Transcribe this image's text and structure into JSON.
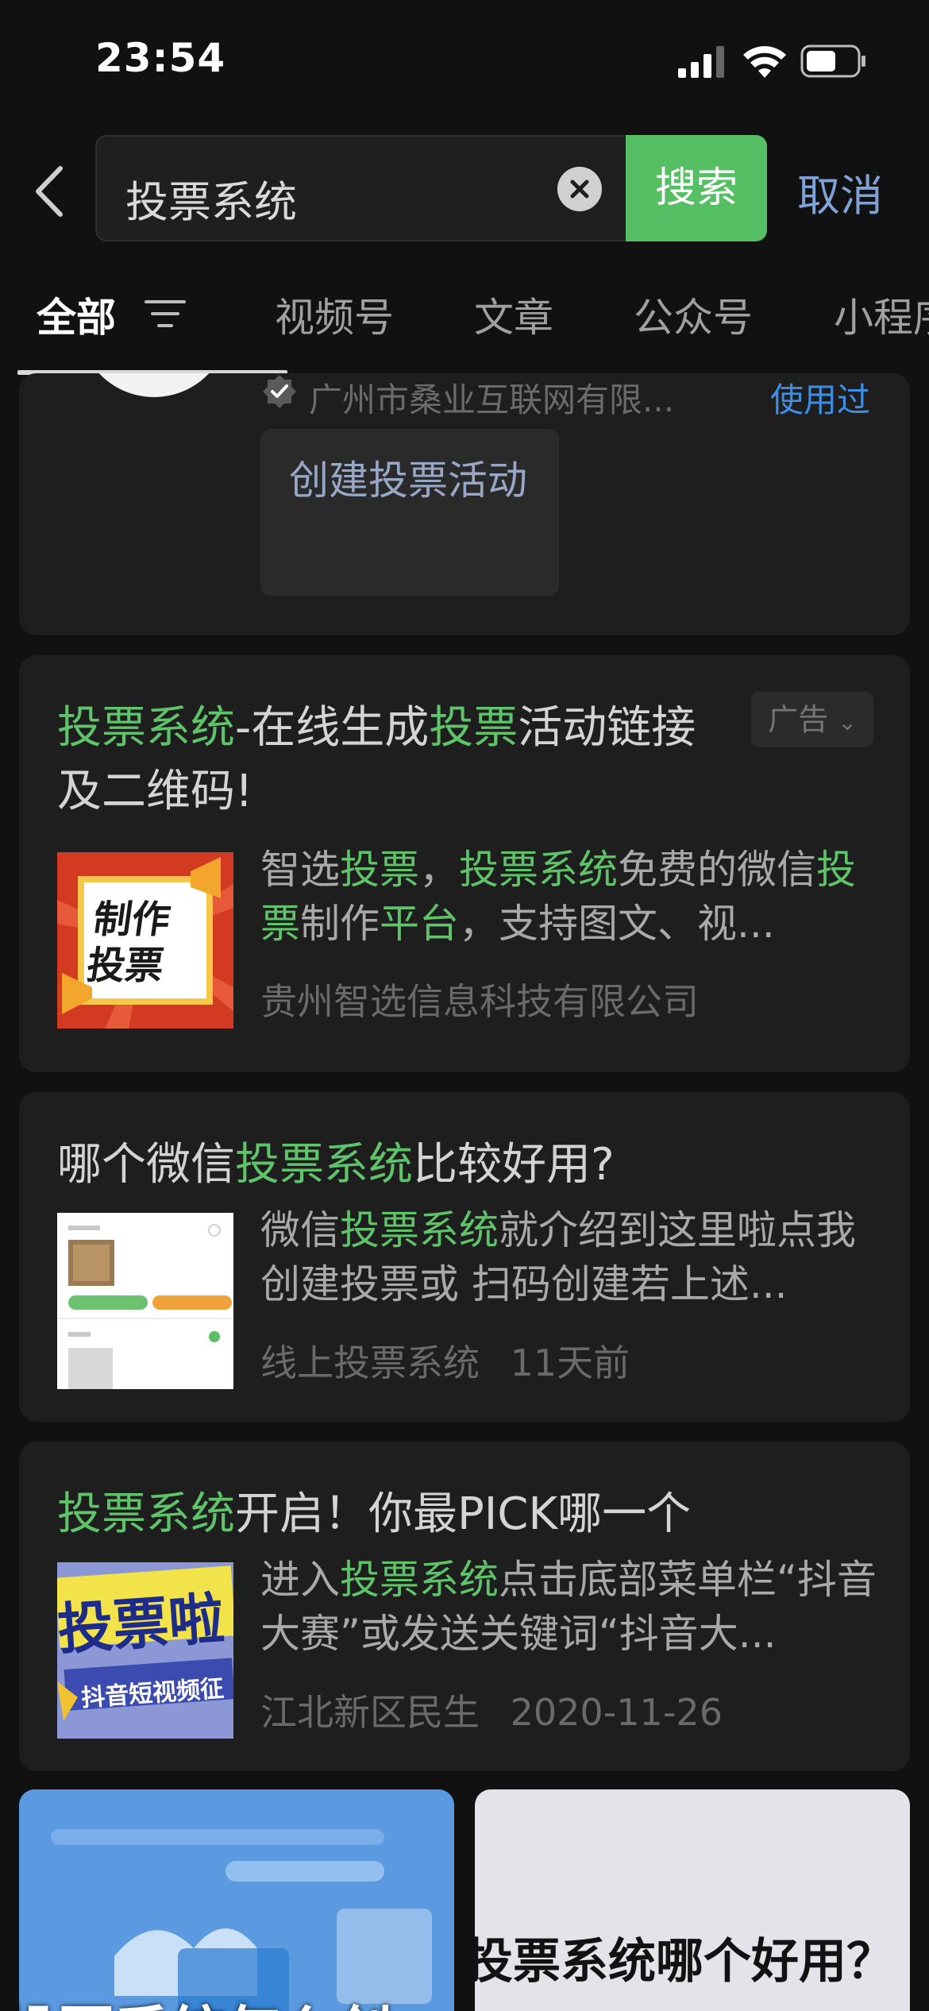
{
  "status_bar": {
    "time": "23:54"
  },
  "search": {
    "query": "投票系统",
    "search_button": "搜索",
    "cancel": "取消"
  },
  "tabs": [
    {
      "label": "全部",
      "active": true
    },
    {
      "label": "视频号",
      "active": false
    },
    {
      "label": "文章",
      "active": false
    },
    {
      "label": "公众号",
      "active": false
    },
    {
      "label": "小程序",
      "active": false
    }
  ],
  "card_mini_program": {
    "company": "广州市桑业互联网有限...",
    "used_label": "使用过",
    "chip_label": "创建投票活动"
  },
  "results": [
    {
      "type": "ad",
      "title_parts": [
        {
          "text": "投票系统",
          "highlight": true
        },
        {
          "text": "-在线生成",
          "highlight": false
        },
        {
          "text": "投票",
          "highlight": true
        },
        {
          "text": "活动链接及二维码!",
          "highlight": false
        }
      ],
      "ad_label": "广告",
      "thumb_text": [
        "制作",
        "投票"
      ],
      "desc_parts": [
        {
          "text": "智选",
          "highlight": false
        },
        {
          "text": "投票",
          "highlight": true
        },
        {
          "text": "，",
          "highlight": false
        },
        {
          "text": "投票系统",
          "highlight": true
        },
        {
          "text": "免费的微信",
          "highlight": false
        },
        {
          "text": "投票",
          "highlight": true
        },
        {
          "text": "制作",
          "highlight": false
        },
        {
          "text": "平台",
          "highlight": true
        },
        {
          "text": "，支持图文、视...",
          "highlight": false
        }
      ],
      "meta": "贵州智选信息科技有限公司"
    },
    {
      "type": "article",
      "title_parts": [
        {
          "text": "哪个微信",
          "highlight": false
        },
        {
          "text": "投票系统",
          "highlight": true
        },
        {
          "text": "比较好用?",
          "highlight": false
        }
      ],
      "desc_parts": [
        {
          "text": "微信",
          "highlight": false
        },
        {
          "text": "投票系统",
          "highlight": true
        },
        {
          "text": "就介绍到这里啦点我创建投票或 扫码创建若上述...",
          "highlight": false
        }
      ],
      "meta_source": "线上投票系统",
      "meta_time": "11天前"
    },
    {
      "type": "article",
      "title_parts": [
        {
          "text": "投票系统",
          "highlight": true
        },
        {
          "text": "开启！你最PICK哪一个",
          "highlight": false
        }
      ],
      "thumb_text": [
        "投票啦",
        "抖音短视频征"
      ],
      "desc_parts": [
        {
          "text": "进入",
          "highlight": false
        },
        {
          "text": "投票系统",
          "highlight": true
        },
        {
          "text": "点击底部菜单栏“抖音大赛”或发送关键词“抖音大...",
          "highlight": false
        }
      ],
      "meta_source": "江北新区民生",
      "meta_time": "2020-11-26"
    }
  ],
  "video_tiles": [
    {
      "caption": "投票系统怎么创"
    },
    {
      "caption": "投票系统哪个好用？"
    }
  ],
  "colors": {
    "highlight": "#5fc36a",
    "search_button": "#56bf63",
    "link": "#3e8ee6",
    "background": "#111111",
    "card": "#1e1e1e"
  }
}
